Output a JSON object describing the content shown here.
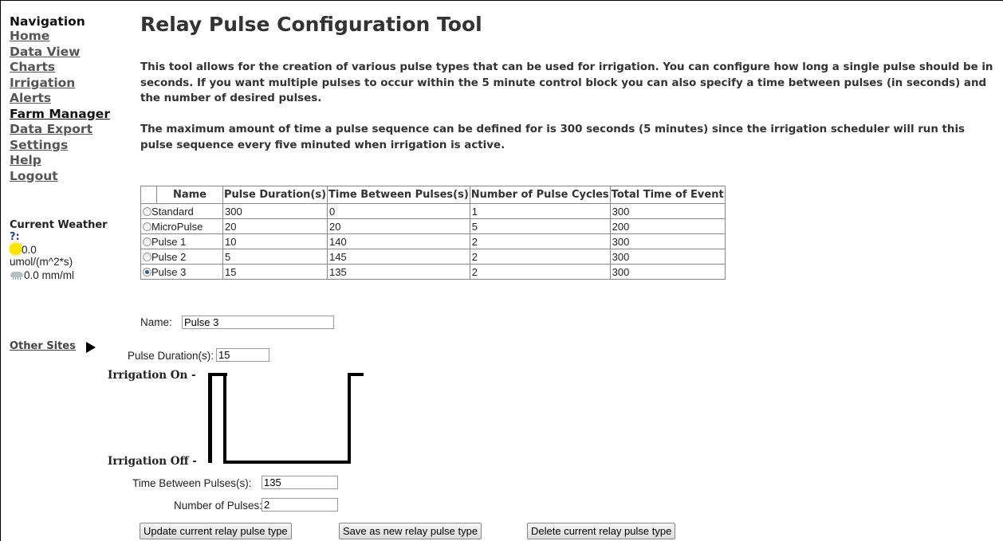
{
  "nav": {
    "title": "Navigation",
    "items": [
      {
        "label": "Home"
      },
      {
        "label": "Data View"
      },
      {
        "label": "Charts"
      },
      {
        "label": "Irrigation"
      },
      {
        "label": "Alerts"
      },
      {
        "label": "Farm Manager",
        "active": true
      },
      {
        "label": "Data Export"
      },
      {
        "label": "Settings"
      },
      {
        "label": "Help"
      },
      {
        "label": "Logout"
      }
    ]
  },
  "weather": {
    "title": "Current Weather",
    "unknown_label": "?:",
    "light_value": "0.0",
    "light_unit": "umol/(m^2*s)",
    "rain": "0.0 mm/ml",
    "sun_icon": "sun-icon",
    "rain_icon": "rain-cloud-icon"
  },
  "other_sites": "Other Sites",
  "page": {
    "title": "Relay Pulse Configuration Tool",
    "para1": "This tool allows for the creation of various pulse types that can be used for irrigation. You can configure how long a single pulse should be in seconds. If you want multiple pulses to occur within the 5 minute control block you can also specify a time between pulses (in seconds) and the number of desired pulses.",
    "para2": "The maximum amount of time a pulse sequence can be defined for is 300 seconds (5 minutes) since the irrigation scheduler will run this pulse sequence every five minuted when irrigation is active."
  },
  "table": {
    "headers": [
      "Name",
      "Pulse Duration(s)",
      "Time Between Pulses(s)",
      "Number of Pulse Cycles",
      "Total Time of Event"
    ],
    "rows": [
      {
        "name": "Standard",
        "duration": "300",
        "between": "0",
        "cycles": "1",
        "total": "300",
        "selected": false
      },
      {
        "name": "MicroPulse",
        "duration": "20",
        "between": "20",
        "cycles": "5",
        "total": "200",
        "selected": false
      },
      {
        "name": "Pulse 1",
        "duration": "10",
        "between": "140",
        "cycles": "2",
        "total": "300",
        "selected": false
      },
      {
        "name": "Pulse 2",
        "duration": "5",
        "between": "145",
        "cycles": "2",
        "total": "300",
        "selected": false
      },
      {
        "name": "Pulse 3",
        "duration": "15",
        "between": "135",
        "cycles": "2",
        "total": "300",
        "selected": true
      }
    ]
  },
  "form": {
    "name_label": "Name:",
    "name_value": "Pulse 3",
    "duration_label": "Pulse Duration(s):",
    "duration_value": "15",
    "between_label": "Time Between Pulses(s):",
    "between_value": "135",
    "count_label": "Number of Pulses:",
    "count_value": "2"
  },
  "diagram": {
    "on_label": "Irrigation On -",
    "off_label": "Irrigation Off -"
  },
  "buttons": {
    "update": "Update current relay pulse type",
    "save": "Save as new relay pulse type",
    "delete": "Delete current relay pulse type"
  }
}
